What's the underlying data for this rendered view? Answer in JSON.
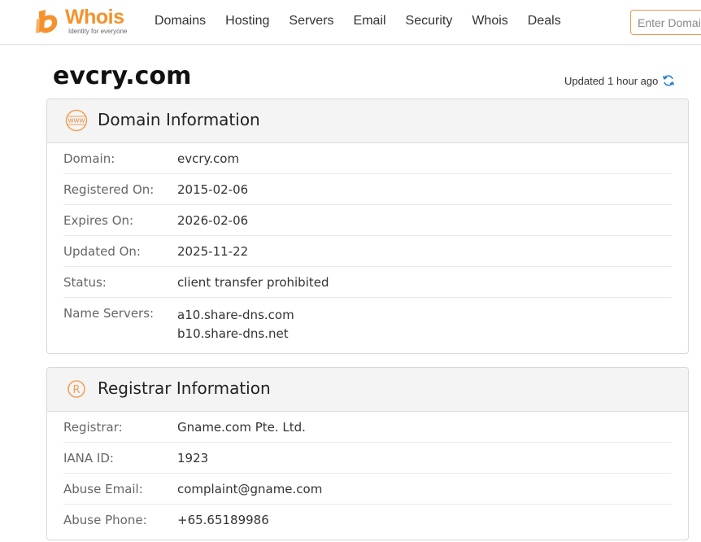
{
  "brand": {
    "name": "Whois",
    "tagline": "Identity for everyone",
    "color": "#f5922b"
  },
  "nav": {
    "items": [
      {
        "label": "Domains"
      },
      {
        "label": "Hosting"
      },
      {
        "label": "Servers"
      },
      {
        "label": "Email"
      },
      {
        "label": "Security"
      },
      {
        "label": "Whois"
      },
      {
        "label": "Deals"
      }
    ]
  },
  "search": {
    "placeholder": "Enter Domain"
  },
  "page": {
    "title": "evcry.com",
    "updated_prefix": "Updated",
    "updated_value": "1 hour ago",
    "updated_icon": "refresh-icon"
  },
  "domain_info": {
    "title": "Domain Information",
    "icon": "www-icon",
    "rows": [
      {
        "key": "Domain:",
        "value": "evcry.com"
      },
      {
        "key": "Registered On:",
        "value": "2015-02-06"
      },
      {
        "key": "Expires On:",
        "value": "2026-02-06"
      },
      {
        "key": "Updated On:",
        "value": "2025-11-22"
      },
      {
        "key": "Status:",
        "value": "client transfer prohibited"
      }
    ],
    "name_servers": {
      "key": "Name Servers:",
      "values": [
        "a10.share-dns.com",
        "b10.share-dns.net"
      ]
    }
  },
  "registrar_info": {
    "title": "Registrar Information",
    "icon": "registered-icon",
    "rows": [
      {
        "key": "Registrar:",
        "value": "Gname.com Pte. Ltd."
      },
      {
        "key": "IANA ID:",
        "value": "1923"
      },
      {
        "key": "Abuse Email:",
        "value": "complaint@gname.com"
      },
      {
        "key": "Abuse Phone:",
        "value": "+65.65189986"
      }
    ]
  }
}
